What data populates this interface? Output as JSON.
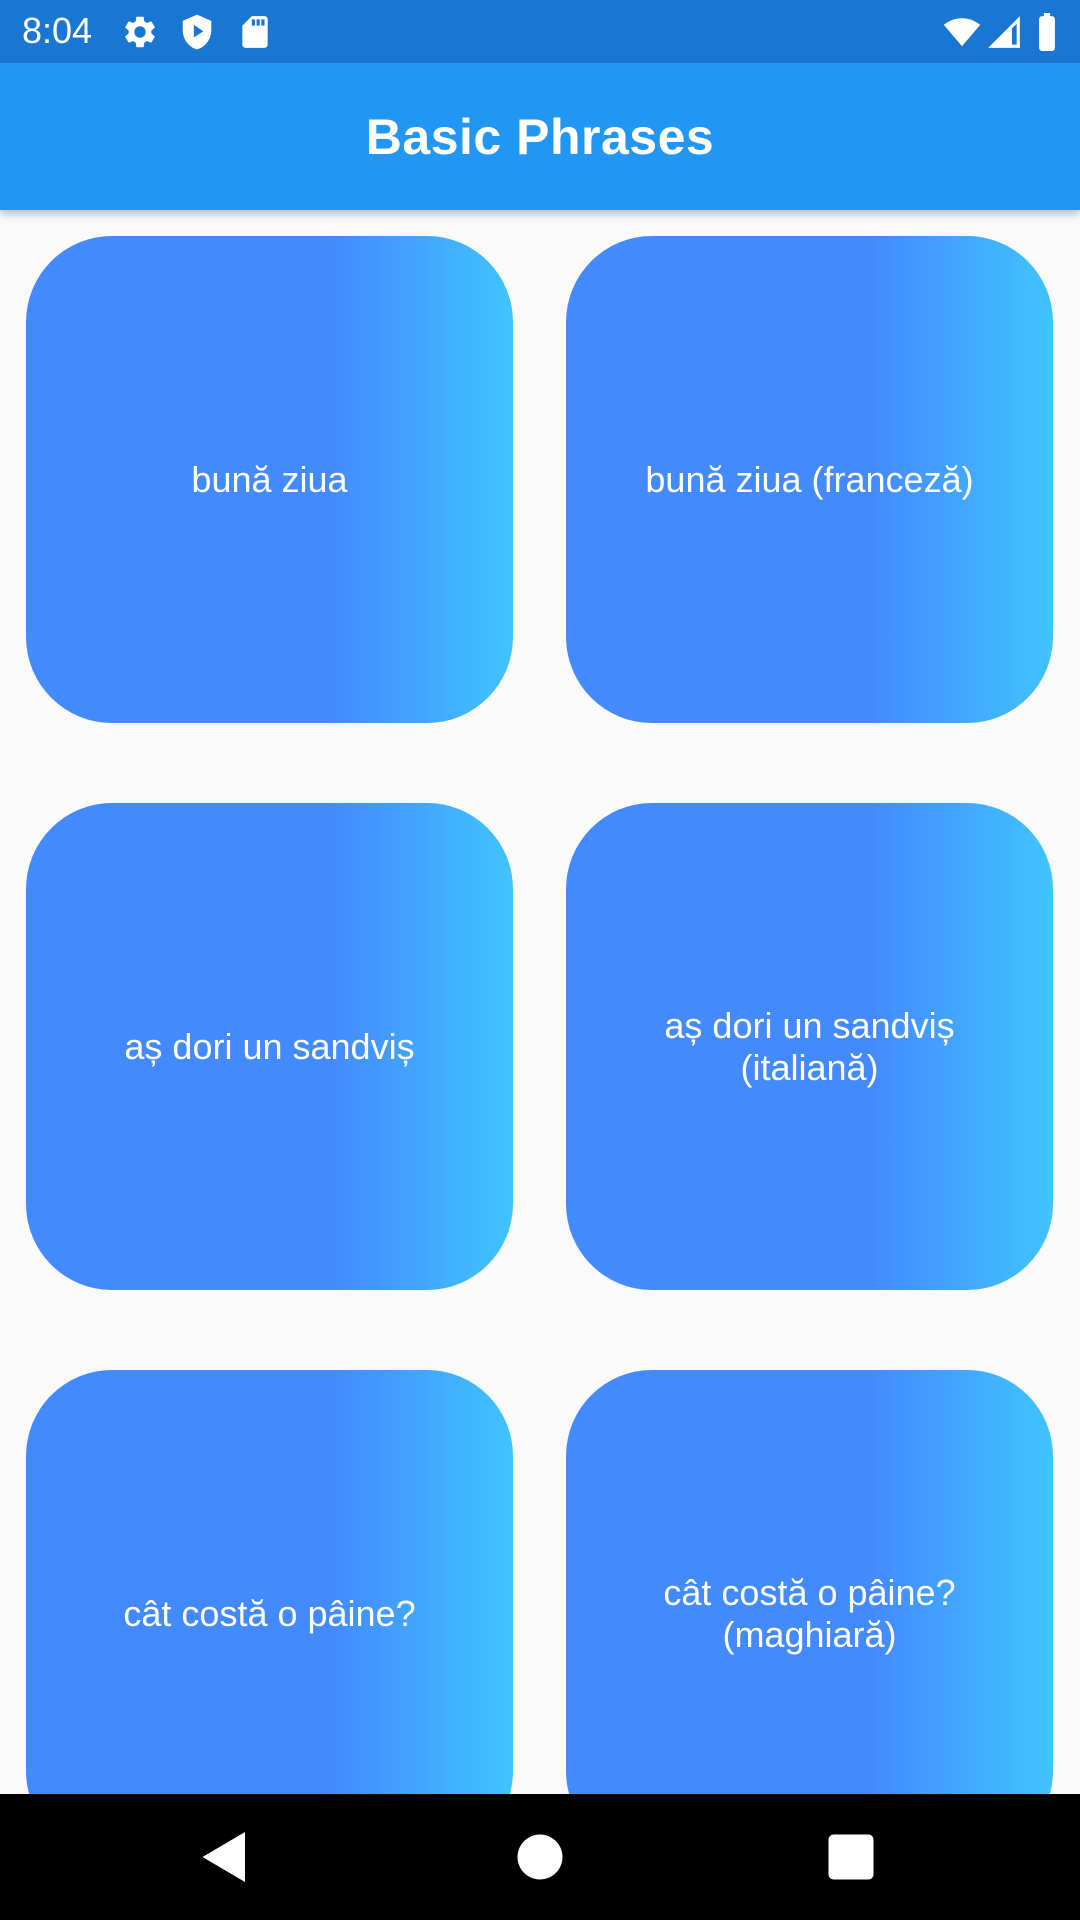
{
  "status_bar": {
    "time": "8:04",
    "left_icons": [
      "gear-icon",
      "shield-play-icon",
      "sd-card-icon"
    ],
    "right_icons": [
      "wifi-icon",
      "signal-icon",
      "battery-icon"
    ]
  },
  "app_bar": {
    "title": "Basic Phrases",
    "color": "#2196f3"
  },
  "tiles": [
    {
      "label": "bună ziua"
    },
    {
      "label": "bună ziua (franceză)"
    },
    {
      "label": "aș dori un sandviș"
    },
    {
      "label": "aș dori un sandviș\n(italiană)"
    },
    {
      "label": "cât costă o pâine?"
    },
    {
      "label": "cât costă o pâine?\n(maghiară)"
    }
  ],
  "colors": {
    "status_bar": "#1976d2",
    "tile_gradient_start": "#448aff",
    "tile_gradient_end": "#40c4ff",
    "background": "#fafafa"
  },
  "nav_bar": {
    "buttons": [
      "back-icon",
      "home-icon",
      "recents-icon"
    ]
  }
}
